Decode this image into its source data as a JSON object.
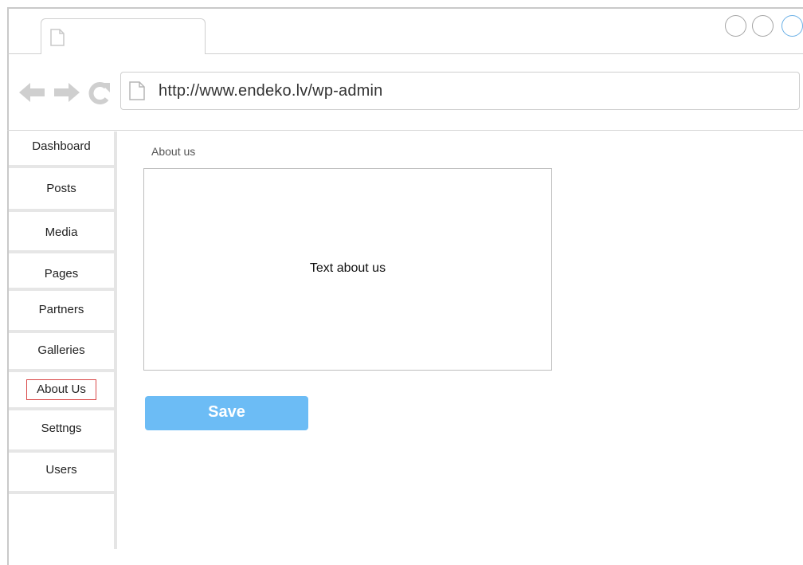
{
  "browser": {
    "url": "http://www.endeko.lv/wp-admin",
    "accent_color": "#6bb0e6"
  },
  "sidebar": {
    "items": [
      {
        "label": "Dashboard",
        "icon": ""
      },
      {
        "label": "Posts"
      },
      {
        "label": "Media"
      },
      {
        "label": "Pages"
      },
      {
        "label": "Partners"
      },
      {
        "label": "Galleries"
      },
      {
        "label": "About Us",
        "active": true
      },
      {
        "label": "Settngs"
      },
      {
        "label": "Users"
      }
    ],
    "active_border_color": "#d94a4a"
  },
  "main": {
    "section_label": "About us",
    "textbox_value": "Text about us",
    "save_label": "Save",
    "save_color": "#6cbcf5"
  },
  "icons": {
    "tab_page": "page-icon",
    "back": "back-arrow-icon",
    "forward": "forward-arrow-icon",
    "reload": "reload-icon",
    "url_page": "page-icon"
  }
}
